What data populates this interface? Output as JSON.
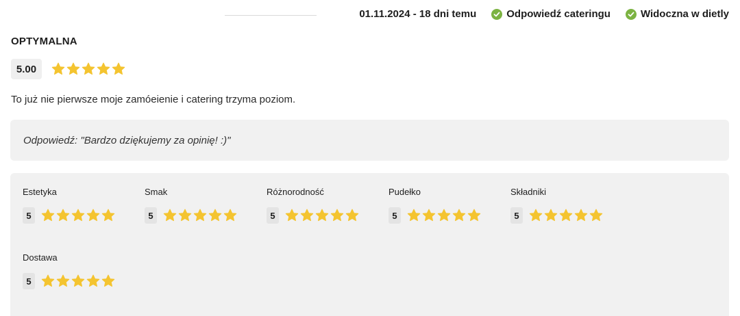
{
  "header": {
    "date_text": "01.11.2024 - 18 dni temu",
    "badge_reply": "Odpowiedź cateringu",
    "badge_visible": "Widoczna w dietly"
  },
  "review": {
    "diet_name": "OPTYMALNA",
    "overall_score": "5.00",
    "overall_stars": 5,
    "comment": "To już nie pierwsze moje zamóeienie i catering trzyma poziom.",
    "reply": "Odpowiedź: \"Bardzo dziękujemy za opinię! :)\""
  },
  "categories": [
    {
      "label": "Estetyka",
      "score": "5",
      "stars": 5
    },
    {
      "label": "Smak",
      "score": "5",
      "stars": 5
    },
    {
      "label": "Różnorodność",
      "score": "5",
      "stars": 5
    },
    {
      "label": "Pudełko",
      "score": "5",
      "stars": 5
    },
    {
      "label": "Składniki",
      "score": "5",
      "stars": 5
    },
    {
      "label": "Dostawa",
      "score": "5",
      "stars": 5
    }
  ],
  "colors": {
    "star": "#f4c430",
    "check": "#7cb342",
    "panel_bg": "#f1f1f1"
  },
  "icons": {
    "check": "check-circle-icon",
    "star": "star-icon"
  }
}
